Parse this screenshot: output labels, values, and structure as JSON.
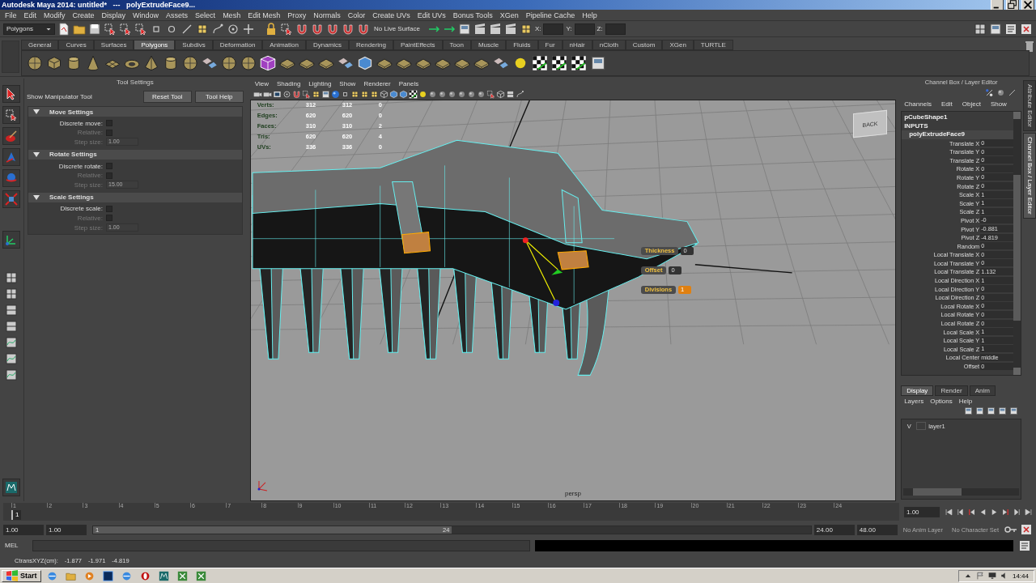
{
  "window": {
    "title": "Autodesk Maya 2014: untitled*   ---   polyExtrudeFace9..."
  },
  "menu_bar": [
    "File",
    "Edit",
    "Modify",
    "Create",
    "Display",
    "Window",
    "Assets",
    "Select",
    "Mesh",
    "Edit Mesh",
    "Proxy",
    "Normals",
    "Color",
    "Create UVs",
    "Edit UVs",
    "Bonus Tools",
    "XGen",
    "Pipeline Cache",
    "Help"
  ],
  "status_line": {
    "mode": "Polygons",
    "live_surface": "No Live Surface",
    "fields": [
      "X:",
      "Y:",
      "Z:"
    ]
  },
  "shelf_tabs": [
    {
      "label": "General",
      "selected": false
    },
    {
      "label": "Curves",
      "selected": false
    },
    {
      "label": "Surfaces",
      "selected": false
    },
    {
      "label": "Polygons",
      "selected": true
    },
    {
      "label": "Subdivs",
      "selected": false
    },
    {
      "label": "Deformation",
      "selected": false
    },
    {
      "label": "Animation",
      "selected": false
    },
    {
      "label": "Dynamics",
      "selected": false
    },
    {
      "label": "Rendering",
      "selected": false
    },
    {
      "label": "PaintEffects",
      "selected": false
    },
    {
      "label": "Toon",
      "selected": false
    },
    {
      "label": "Muscle",
      "selected": false
    },
    {
      "label": "Fluids",
      "selected": false
    },
    {
      "label": "Fur",
      "selected": false
    },
    {
      "label": "nHair",
      "selected": false
    },
    {
      "label": "nCloth",
      "selected": false
    },
    {
      "label": "Custom",
      "selected": false
    },
    {
      "label": "XGen",
      "selected": false
    },
    {
      "label": "TURTLE",
      "selected": false
    }
  ],
  "tool_settings": {
    "title": "Tool Settings",
    "tool_name": "Show Manipulator Tool",
    "buttons": [
      "Reset Tool",
      "Tool Help"
    ],
    "sections": [
      {
        "title": "Move Settings",
        "expanded": true,
        "rows": [
          {
            "kind": "checkbox",
            "label": "Discrete move:",
            "checked": false,
            "disabled": false
          },
          {
            "kind": "checkbox",
            "label": "Relative:",
            "checked": false,
            "disabled": true
          },
          {
            "kind": "number",
            "label": "Step size:",
            "value": "1.00",
            "disabled": true
          }
        ]
      },
      {
        "title": "Rotate Settings",
        "expanded": true,
        "rows": [
          {
            "kind": "checkbox",
            "label": "Discrete rotate:",
            "checked": false,
            "disabled": false
          },
          {
            "kind": "checkbox",
            "label": "Relative:",
            "checked": false,
            "disabled": true
          },
          {
            "kind": "number",
            "label": "Step size:",
            "value": "15.00",
            "disabled": true
          }
        ]
      },
      {
        "title": "Scale Settings",
        "expanded": true,
        "rows": [
          {
            "kind": "checkbox",
            "label": "Discrete scale:",
            "checked": false,
            "disabled": false
          },
          {
            "kind": "checkbox",
            "label": "Relative:",
            "checked": false,
            "disabled": true
          },
          {
            "kind": "number",
            "label": "Step size:",
            "value": "1.00",
            "disabled": true
          }
        ]
      }
    ]
  },
  "viewport": {
    "menu": [
      "View",
      "Shading",
      "Lighting",
      "Show",
      "Renderer",
      "Panels"
    ],
    "hud": [
      {
        "label": "Verts:",
        "values": [
          "312",
          "312",
          "0"
        ]
      },
      {
        "label": "Edges:",
        "values": [
          "620",
          "620",
          "0"
        ]
      },
      {
        "label": "Faces:",
        "values": [
          "310",
          "310",
          "2"
        ]
      },
      {
        "label": "Tris:",
        "values": [
          "620",
          "620",
          "4"
        ]
      },
      {
        "label": "UVs:",
        "values": [
          "336",
          "336",
          "0"
        ]
      }
    ],
    "extrude_fields": [
      {
        "label": "Thickness",
        "value": "0",
        "selected": false
      },
      {
        "label": "Offset",
        "value": "0",
        "selected": false
      },
      {
        "label": "Divisions",
        "value": "1",
        "selected": true
      }
    ],
    "view_cube": "BACK",
    "camera": "persp"
  },
  "channel_box": {
    "title": "Channel Box / Layer Editor",
    "menu": [
      "Channels",
      "Edit",
      "Object",
      "Show"
    ],
    "object": "pCubeShape1",
    "section": "INPUTS",
    "node": "polyExtrudeFace9",
    "channels": [
      {
        "name": "Translate X",
        "value": "0"
      },
      {
        "name": "Translate Y",
        "value": "0"
      },
      {
        "name": "Translate Z",
        "value": "0"
      },
      {
        "name": "Rotate X",
        "value": "0"
      },
      {
        "name": "Rotate Y",
        "value": "0"
      },
      {
        "name": "Rotate Z",
        "value": "0"
      },
      {
        "name": "Scale X",
        "value": "1"
      },
      {
        "name": "Scale Y",
        "value": "1"
      },
      {
        "name": "Scale Z",
        "value": "1"
      },
      {
        "name": "Pivot X",
        "value": "-0"
      },
      {
        "name": "Pivot Y",
        "value": "-0.881"
      },
      {
        "name": "Pivot Z",
        "value": "-4.819"
      },
      {
        "name": "Random",
        "value": "0"
      },
      {
        "name": "Local Translate X",
        "value": "0"
      },
      {
        "name": "Local Translate Y",
        "value": "0"
      },
      {
        "name": "Local Translate Z",
        "value": "1.132"
      },
      {
        "name": "Local Direction X",
        "value": "1"
      },
      {
        "name": "Local Direction Y",
        "value": "0"
      },
      {
        "name": "Local Direction Z",
        "value": "0"
      },
      {
        "name": "Local Rotate X",
        "value": "0"
      },
      {
        "name": "Local Rotate Y",
        "value": "0"
      },
      {
        "name": "Local Rotate Z",
        "value": "0"
      },
      {
        "name": "Local Scale X",
        "value": "1"
      },
      {
        "name": "Local Scale Y",
        "value": "1"
      },
      {
        "name": "Local Scale Z",
        "value": "1"
      },
      {
        "name": "Local Center",
        "value": "middle"
      },
      {
        "name": "Offset",
        "value": "0"
      }
    ]
  },
  "side_tabs": [
    {
      "label": "Attribute Editor",
      "selected": false
    },
    {
      "label": "Channel Box / Layer Editor",
      "selected": true
    }
  ],
  "layer_editor": {
    "tabs": [
      {
        "label": "Display",
        "selected": true
      },
      {
        "label": "Render",
        "selected": false
      },
      {
        "label": "Anim",
        "selected": false
      }
    ],
    "menu": [
      "Layers",
      "Options",
      "Help"
    ],
    "layers": [
      {
        "visibility": "V",
        "name": "layer1"
      }
    ]
  },
  "time_slider": {
    "ticks": [
      "1",
      "2",
      "3",
      "4",
      "5",
      "6",
      "7",
      "8",
      "9",
      "10",
      "11",
      "12",
      "13",
      "14",
      "15",
      "16",
      "17",
      "18",
      "19",
      "20",
      "21",
      "22",
      "23",
      "24"
    ],
    "current_frame": "1",
    "level": 0,
    "current_time": "1.00"
  },
  "range_slider": {
    "start": "1.00",
    "playback_start": "1.00",
    "range_start": "1",
    "range_end": "24",
    "level": 0.5,
    "playback_end": "24.00",
    "end": "48.00",
    "anim_layer": "No Anim Layer",
    "character_set": "No Character Set"
  },
  "command_line": {
    "label": "MEL"
  },
  "help_line": {
    "label": "CtransXYZ(cm):",
    "values": [
      "-1.877",
      "-1.971",
      "-4.819"
    ]
  },
  "taskbar": {
    "start": "Start",
    "clock": "14:44"
  }
}
